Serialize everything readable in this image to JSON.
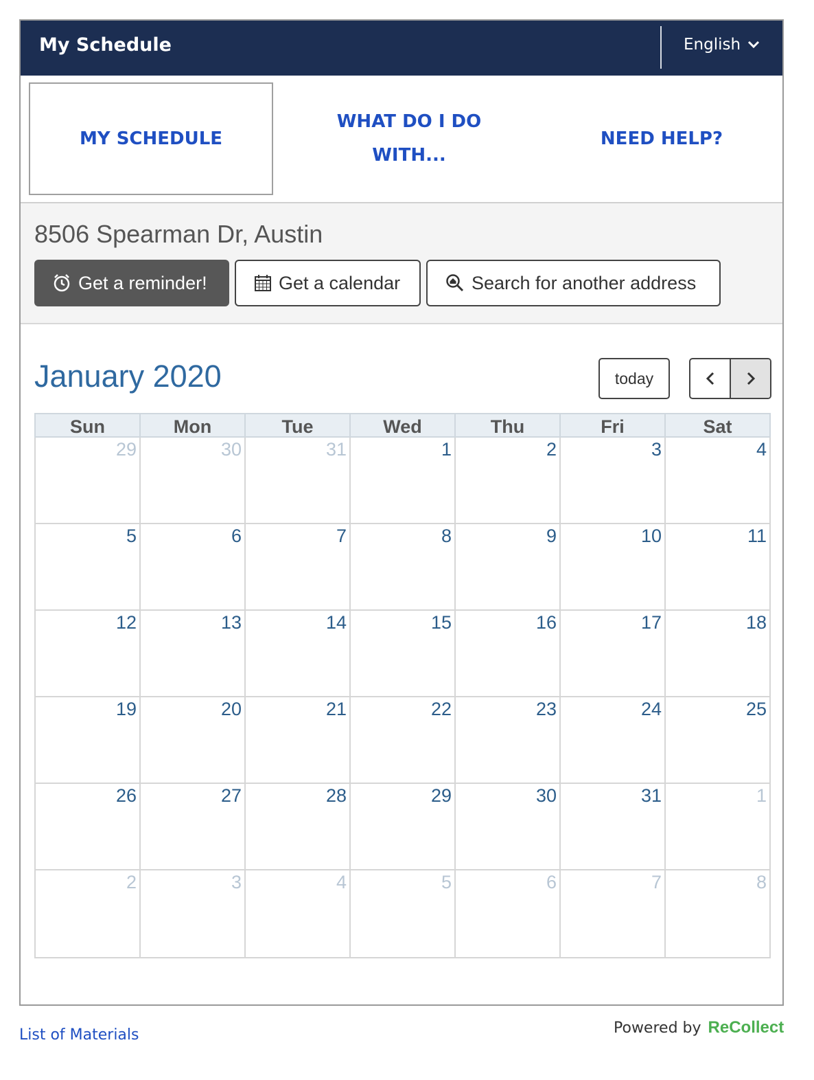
{
  "header": {
    "title": "My Schedule",
    "language": "English"
  },
  "nav": [
    {
      "label": "MY SCHEDULE",
      "active": true
    },
    {
      "label": "WHAT DO I DO WITH...",
      "active": false
    },
    {
      "label": "NEED HELP?",
      "active": false
    }
  ],
  "address": {
    "text": "8506 Spearman Dr, Austin",
    "reminder_label": "Get a reminder!",
    "calendar_label": "Get a calendar",
    "search_label": "Search for another address"
  },
  "calendar": {
    "month_label": "January 2020",
    "today_label": "today",
    "weekdays": [
      "Sun",
      "Mon",
      "Tue",
      "Wed",
      "Thu",
      "Fri",
      "Sat"
    ],
    "weeks": [
      [
        {
          "d": "29",
          "o": true
        },
        {
          "d": "30",
          "o": true
        },
        {
          "d": "31",
          "o": true
        },
        {
          "d": "1"
        },
        {
          "d": "2"
        },
        {
          "d": "3"
        },
        {
          "d": "4"
        }
      ],
      [
        {
          "d": "5"
        },
        {
          "d": "6"
        },
        {
          "d": "7"
        },
        {
          "d": "8"
        },
        {
          "d": "9"
        },
        {
          "d": "10"
        },
        {
          "d": "11"
        }
      ],
      [
        {
          "d": "12"
        },
        {
          "d": "13"
        },
        {
          "d": "14"
        },
        {
          "d": "15"
        },
        {
          "d": "16"
        },
        {
          "d": "17"
        },
        {
          "d": "18"
        }
      ],
      [
        {
          "d": "19"
        },
        {
          "d": "20"
        },
        {
          "d": "21"
        },
        {
          "d": "22"
        },
        {
          "d": "23"
        },
        {
          "d": "24"
        },
        {
          "d": "25"
        }
      ],
      [
        {
          "d": "26"
        },
        {
          "d": "27"
        },
        {
          "d": "28"
        },
        {
          "d": "29"
        },
        {
          "d": "30"
        },
        {
          "d": "31"
        },
        {
          "d": "1",
          "o": true
        }
      ],
      [
        {
          "d": "2",
          "o": true
        },
        {
          "d": "3",
          "o": true
        },
        {
          "d": "4",
          "o": true
        },
        {
          "d": "5",
          "o": true
        },
        {
          "d": "6",
          "o": true
        },
        {
          "d": "7",
          "o": true
        },
        {
          "d": "8",
          "o": true
        }
      ]
    ]
  },
  "footer": {
    "link": "List of Materials",
    "powered_by": "Powered by",
    "brand": "ReCollect"
  },
  "colors": {
    "header_bg": "#1c2e52",
    "nav_link": "#1f4fc2",
    "month_title": "#2f69a0",
    "brand": "#4caf50"
  },
  "icons": {
    "reminder": "alarm-clock-icon",
    "calendar": "calendar-icon",
    "search": "search-home-icon"
  }
}
